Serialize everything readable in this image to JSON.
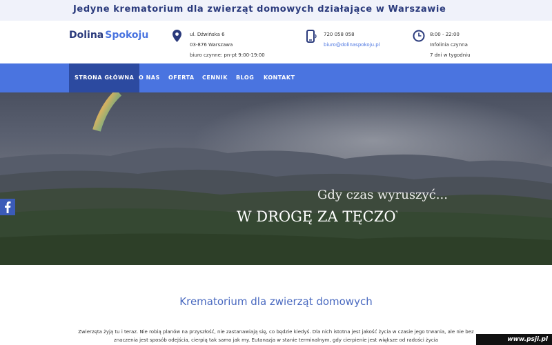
{
  "topbar": {
    "tagline": "Jedyne krematorium dla zwierząt domowych działające w Warszawie"
  },
  "logo": {
    "part1": "Dolina",
    "part2": "Spokoju"
  },
  "address": {
    "line1": "ul. Dźwińska 6",
    "line2": "03-876 Warszawa",
    "line3": "biuro czynne: pn-pt 9:00-19:00"
  },
  "contact": {
    "phone": "720 058 058",
    "email": "biuro@dolinaspokoju.pl"
  },
  "hours": {
    "line1": "8:00 - 22:00",
    "line2": "Infolinia czynna",
    "line3": "7 dni w tygodniu"
  },
  "nav": {
    "items": [
      "STRONA GŁÓWNA",
      "O NAS",
      "OFERTA",
      "CENNIK",
      "BLOG",
      "KONTAKT"
    ]
  },
  "hero": {
    "subtitle": "Gdy czas wyruszyć...",
    "title": "W DROGĘ ZA TĘCZOWY MOST"
  },
  "content": {
    "title": "Krematorium dla zwierząt domowych",
    "text": "Zwierzęta żyją tu i teraz. Nie robią planów na przyszłość, nie zastanawiają się, co będzie kiedyś. Dla nich istotna jest jakość życia w czasie jego trwania, ale nie bez znaczenia jest sposób odejścia, cierpią tak samo jak my. Eutanazja w stanie terminalnym, gdy cierpienie jest większe od radości życia"
  },
  "watermark": "www.psji.pl",
  "colors": {
    "brand_dark": "#2a3a7c",
    "accent": "#4a74e0",
    "nav_active": "#2c4aa0",
    "facebook": "#3b5bb8"
  },
  "icons": [
    "location-pin-icon",
    "phone-icon",
    "clock-icon",
    "facebook-icon"
  ]
}
